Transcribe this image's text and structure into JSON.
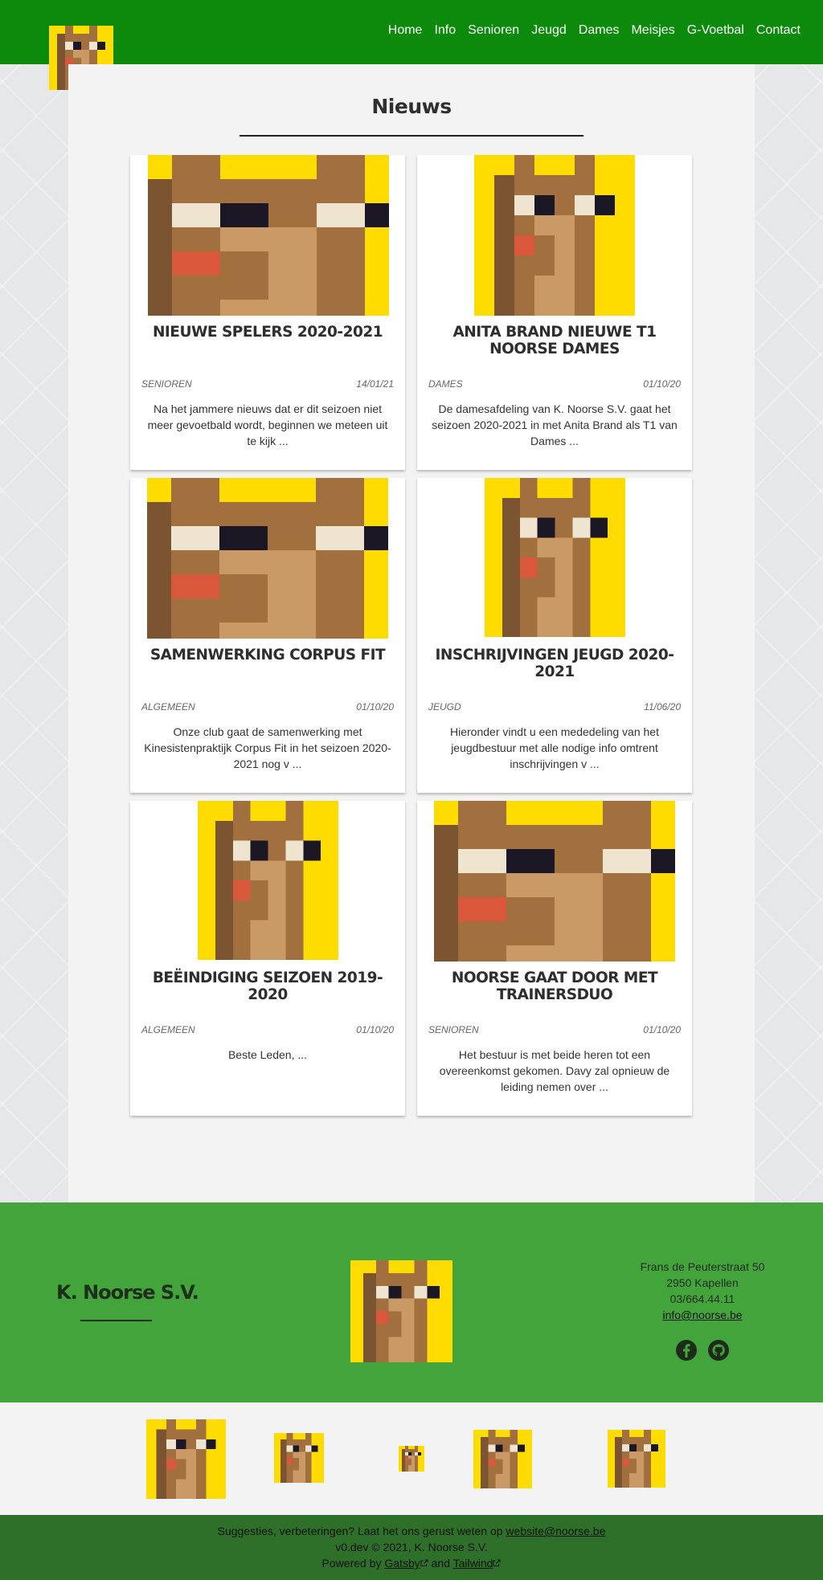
{
  "header": {
    "logo_alt": "K. Noorse S.V. logo",
    "nav": [
      "Home",
      "Info",
      "Senioren",
      "Jeugd",
      "Dames",
      "Meisjes",
      "G-Voetbal",
      "Contact"
    ]
  },
  "page_title": "Nieuws",
  "articles": [
    {
      "title": "NIEUWE SPELERS 2020-2021",
      "category": "SENIOREN",
      "date": "14/01/21",
      "excerpt": "Na het jammere nieuws dat er dit seizoen niet meer gevoetbald wordt, beginnen we meteen uit te kijk ..."
    },
    {
      "title": "ANITA BRAND NIEUWE T1 NOORSE DAMES",
      "category": "DAMES",
      "date": "01/10/20",
      "excerpt": "De damesafdeling van K. Noorse S.V. gaat het seizoen 2020-2021 in met Anita Brand als T1 van Dames ..."
    },
    {
      "title": "SAMENWERKING CORPUS FIT",
      "category": "ALGEMEEN",
      "date": "01/10/20",
      "excerpt": "Onze club gaat de samenwerking met Kinesistenpraktijk Corpus Fit in het seizoen 2020-2021 nog v ..."
    },
    {
      "title": "INSCHRIJVINGEN JEUGD 2020-2021",
      "category": "JEUGD",
      "date": "11/06/20",
      "excerpt": "Hieronder vindt u een mededeling van het jeugdbestuur met alle nodige info omtrent inschrijvingen v ..."
    },
    {
      "title": "BEËINDIGING SEIZOEN 2019-2020",
      "category": "ALGEMEEN",
      "date": "01/10/20",
      "excerpt": "Beste Leden,   ..."
    },
    {
      "title": "NOORSE GAAT DOOR MET TRAINERSDUO",
      "category": "SENIOREN",
      "date": "01/10/20",
      "excerpt": "Het bestuur is met beide heren tot een overeenkomst gekomen. Davy zal opnieuw de leiding nemen over ..."
    }
  ],
  "footer": {
    "brand": "K. Noorse S.V.",
    "address": {
      "street": "Frans de Peuterstraat 50",
      "city": "2950 Kapellen",
      "phone": "03/664.44.11",
      "email": "info@noorse.be"
    },
    "social": [
      "facebook-icon",
      "github-icon"
    ]
  },
  "bottom": {
    "suggest_text": "Suggesties, verbeteringen? Laat het ons gerust weten op",
    "suggest_email": "website@noorse.be",
    "version": "v0.dev © 2021, K. Noorse S.V.",
    "powered_by": "Powered by",
    "gatsby": "Gatsby",
    "and": "and",
    "tailwind": "Tailwind"
  },
  "colors": {
    "header_green": "#0b8a0b",
    "footer_green": "#43a43b",
    "bottom_green": "#2e6f2a",
    "logo_yellow": "#ffdc00"
  }
}
